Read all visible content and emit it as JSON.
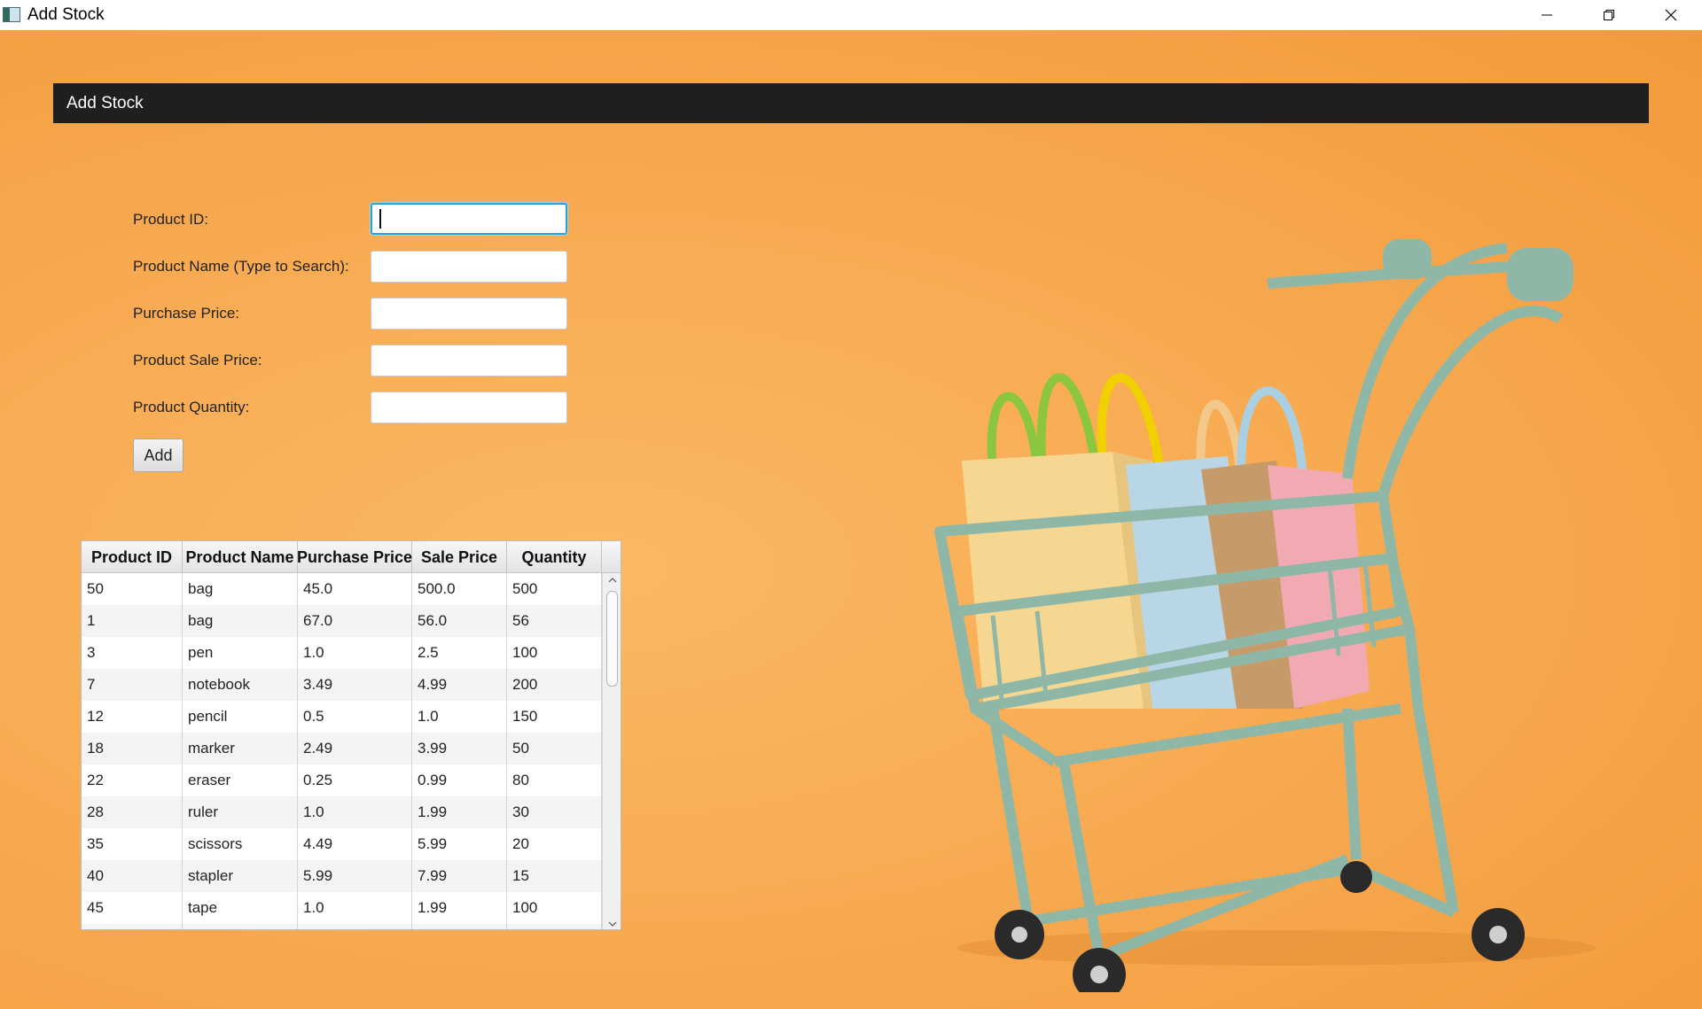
{
  "window": {
    "title": "Add Stock",
    "icon": "app-window-icon"
  },
  "header": {
    "title": "Add Stock"
  },
  "form": {
    "product_id_label": "Product ID:",
    "product_id_value": "",
    "product_name_label": "Product Name (Type to Search):",
    "product_name_value": "",
    "purchase_price_label": "Purchase Price:",
    "purchase_price_value": "",
    "sale_price_label": "Product Sale Price:",
    "sale_price_value": "",
    "quantity_label": "Product Quantity:",
    "quantity_value": "",
    "add_button_label": "Add"
  },
  "table": {
    "columns": [
      "Product ID",
      "Product Name",
      "Purchase Price",
      "Sale Price",
      "Quantity"
    ],
    "rows": [
      [
        "50",
        "bag",
        "45.0",
        "500.0",
        "500"
      ],
      [
        "1",
        "bag",
        "67.0",
        "56.0",
        "56"
      ],
      [
        "3",
        "pen",
        "1.0",
        "2.5",
        "100"
      ],
      [
        "7",
        "notebook",
        "3.49",
        "4.99",
        "200"
      ],
      [
        "12",
        "pencil",
        "0.5",
        "1.0",
        "150"
      ],
      [
        "18",
        "marker",
        "2.49",
        "3.99",
        "50"
      ],
      [
        "22",
        "eraser",
        "0.25",
        "0.99",
        "80"
      ],
      [
        "28",
        "ruler",
        "1.0",
        "1.99",
        "30"
      ],
      [
        "35",
        "scissors",
        "4.49",
        "5.99",
        "20"
      ],
      [
        "40",
        "stapler",
        "5.99",
        "7.99",
        "15"
      ],
      [
        "45",
        "tape",
        "1.0",
        "1.99",
        "100"
      ],
      [
        "",
        "",
        "",
        "",
        ""
      ]
    ]
  },
  "colors": {
    "background": "#f6a84a",
    "header_bar": "#1f1f1f",
    "focus_border": "#2aa3d4",
    "cart": "#8fb7a8"
  },
  "image": {
    "subject": "shopping-cart-with-bags"
  }
}
